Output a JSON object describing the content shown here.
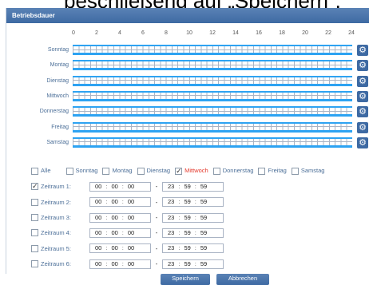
{
  "overlay_caption": "beschließend auf „Speichern“.",
  "title": "Betriebsdauer",
  "hours": [
    "0",
    "2",
    "4",
    "6",
    "8",
    "10",
    "12",
    "14",
    "16",
    "18",
    "20",
    "22",
    "24"
  ],
  "days": [
    "Sonntag",
    "Montag",
    "Dienstag",
    "Mittwoch",
    "Donnerstag",
    "Freitag",
    "Samstag"
  ],
  "day_checks": [
    {
      "label": "Alle",
      "checked": false
    },
    {
      "label": "Sonntag",
      "checked": false
    },
    {
      "label": "Montag",
      "checked": false
    },
    {
      "label": "Dienstag",
      "checked": false
    },
    {
      "label": "Mittwoch",
      "checked": true
    },
    {
      "label": "Donnerstag",
      "checked": false
    },
    {
      "label": "Freitag",
      "checked": false
    },
    {
      "label": "Samstag",
      "checked": false
    }
  ],
  "periods": [
    {
      "label": "Zeitraum 1:",
      "checked": true,
      "start": [
        "00",
        "00",
        "00"
      ],
      "end": [
        "23",
        "59",
        "59"
      ]
    },
    {
      "label": "Zeitraum 2:",
      "checked": false,
      "start": [
        "00",
        "00",
        "00"
      ],
      "end": [
        "23",
        "59",
        "59"
      ]
    },
    {
      "label": "Zeitraum 3:",
      "checked": false,
      "start": [
        "00",
        "00",
        "00"
      ],
      "end": [
        "23",
        "59",
        "59"
      ]
    },
    {
      "label": "Zeitraum 4:",
      "checked": false,
      "start": [
        "00",
        "00",
        "00"
      ],
      "end": [
        "23",
        "59",
        "59"
      ]
    },
    {
      "label": "Zeitraum 5:",
      "checked": false,
      "start": [
        "00",
        "00",
        "00"
      ],
      "end": [
        "23",
        "59",
        "59"
      ]
    },
    {
      "label": "Zeitraum 6:",
      "checked": false,
      "start": [
        "00",
        "00",
        "00"
      ],
      "end": [
        "23",
        "59",
        "59"
      ]
    }
  ],
  "time_sep": ":",
  "range_dash": "-",
  "buttons": {
    "save": "Speichern",
    "cancel": "Abbrechen"
  },
  "colors": {
    "titlebar": "#3e6aa3",
    "timeline": "#2ea3f2",
    "label": "#4c6f98",
    "highlight": "#e4392c"
  }
}
